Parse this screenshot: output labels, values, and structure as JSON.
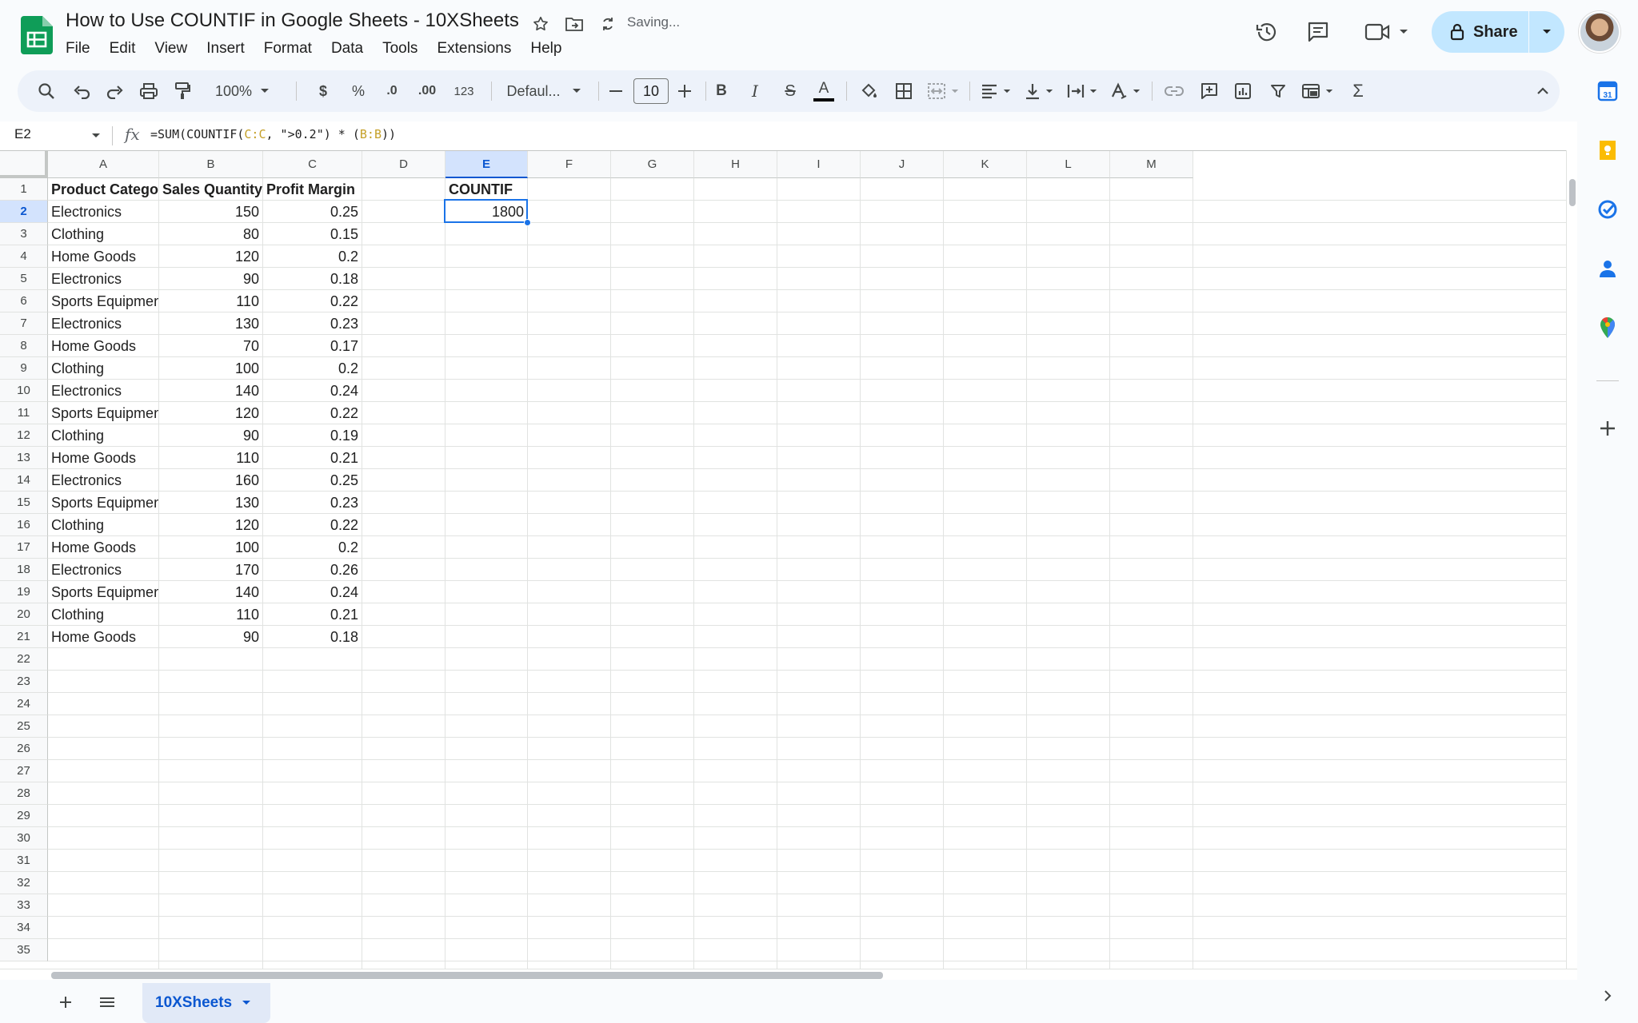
{
  "app": {
    "doc_title": "How to Use COUNTIF in Google Sheets - 10XSheets",
    "save_status": "Saving...",
    "share_label": "Share"
  },
  "menu": [
    "File",
    "Edit",
    "View",
    "Insert",
    "Format",
    "Data",
    "Tools",
    "Extensions",
    "Help"
  ],
  "toolbar": {
    "zoom": "100%",
    "currency": "$",
    "percent": "%",
    "decrease_decimal": ".0",
    "increase_decimal": ".00",
    "number_format": "123",
    "font": "Defaul...",
    "font_size": "10",
    "bold": "B",
    "italic": "I",
    "strikethrough": "S",
    "text_color": "A",
    "functions": "Σ"
  },
  "formula_bar": {
    "name_box": "E2",
    "fx": "fx",
    "formula_parts": [
      "=SUM(COUNTIF(",
      "C:C",
      ", \">0.2\") * (",
      "B:B",
      "))"
    ]
  },
  "grid": {
    "columns": [
      "A",
      "B",
      "C",
      "D",
      "E",
      "F",
      "G",
      "H",
      "I",
      "J",
      "K",
      "L",
      "M"
    ],
    "selected_column": "E",
    "selected_row": 2,
    "row_numbers": [
      1,
      2,
      3,
      4,
      5,
      6,
      7,
      8,
      9,
      10,
      11,
      12,
      13,
      14,
      15,
      16,
      17,
      18,
      19,
      20,
      21,
      22,
      23,
      24,
      25,
      26,
      27,
      28,
      29,
      30,
      31,
      32,
      33,
      34,
      35
    ],
    "headers": [
      "Product Category",
      "Sales Quantity",
      "Profit Margin"
    ],
    "rows": [
      [
        "Electronics",
        "150",
        "0.25"
      ],
      [
        "Clothing",
        "80",
        "0.15"
      ],
      [
        "Home Goods",
        "120",
        "0.2"
      ],
      [
        "Electronics",
        "90",
        "0.18"
      ],
      [
        "Sports Equipment",
        "110",
        "0.22"
      ],
      [
        "Electronics",
        "130",
        "0.23"
      ],
      [
        "Home Goods",
        "70",
        "0.17"
      ],
      [
        "Clothing",
        "100",
        "0.2"
      ],
      [
        "Electronics",
        "140",
        "0.24"
      ],
      [
        "Sports Equipment",
        "120",
        "0.22"
      ],
      [
        "Clothing",
        "90",
        "0.19"
      ],
      [
        "Home Goods",
        "110",
        "0.21"
      ],
      [
        "Electronics",
        "160",
        "0.25"
      ],
      [
        "Sports Equipment",
        "130",
        "0.23"
      ],
      [
        "Clothing",
        "120",
        "0.22"
      ],
      [
        "Home Goods",
        "100",
        "0.2"
      ],
      [
        "Electronics",
        "170",
        "0.26"
      ],
      [
        "Sports Equipment",
        "140",
        "0.24"
      ],
      [
        "Clothing",
        "110",
        "0.21"
      ],
      [
        "Home Goods",
        "90",
        "0.18"
      ]
    ],
    "e1_label": "COUNTIF",
    "e2_value": "1800"
  },
  "sheet_tab": "10XSheets",
  "colors": {
    "accent": "#1a73e8",
    "share_bg": "#c2e7ff",
    "toolbar_bg": "#edf2fa",
    "formula_ref": "#c5a028",
    "selected_header": "#d3e3fd"
  },
  "side_icons": [
    "calendar-icon",
    "keep-icon",
    "tasks-icon",
    "contacts-icon",
    "maps-icon",
    "add-icon"
  ]
}
